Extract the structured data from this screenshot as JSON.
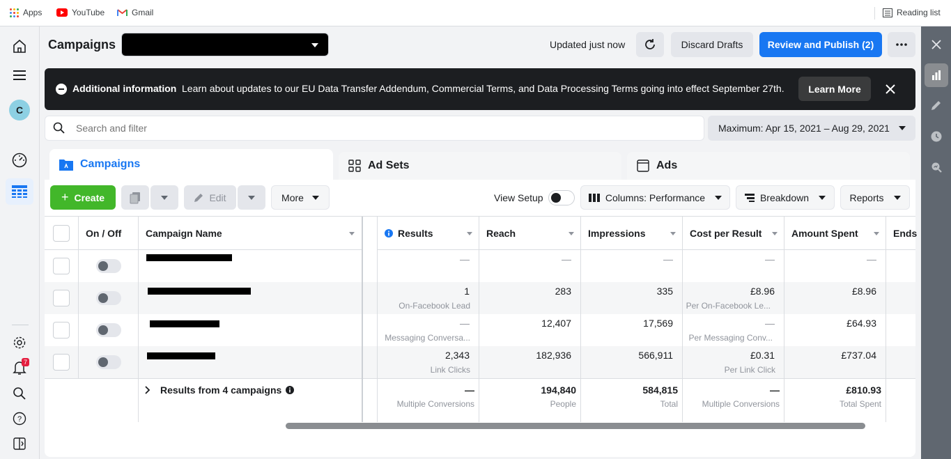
{
  "bookmarks": {
    "apps": "Apps",
    "youtube": "YouTube",
    "gmail": "Gmail",
    "reading_list": "Reading list"
  },
  "header": {
    "title": "Campaigns",
    "updated": "Updated just now",
    "discard": "Discard Drafts",
    "publish": "Review and Publish (2)"
  },
  "banner": {
    "title": "Additional information",
    "message": "Learn about updates to our EU Data Transfer Addendum, Commercial Terms, and Data Processing Terms going into effect September 27th.",
    "learn_more": "Learn More"
  },
  "search": {
    "placeholder": "Search and filter"
  },
  "date_range": "Maximum: Apr 15, 2021 – Aug 29, 2021",
  "tabs": {
    "campaigns": "Campaigns",
    "adsets": "Ad Sets",
    "ads": "Ads"
  },
  "toolbar": {
    "create": "Create",
    "edit": "Edit",
    "more": "More",
    "view_setup": "View Setup",
    "columns": "Columns: Performance",
    "breakdown": "Breakdown",
    "reports": "Reports"
  },
  "table": {
    "headers": {
      "onoff": "On / Off",
      "name": "Campaign Name",
      "results": "Results",
      "reach": "Reach",
      "impressions": "Impressions",
      "cpr": "Cost per Result",
      "amount": "Amount Spent",
      "ends": "Ends"
    },
    "rows": [
      {
        "results": "—",
        "results_sub": "",
        "reach": "—",
        "impressions": "—",
        "cpr": "—",
        "cpr_sub": "",
        "amount": "—"
      },
      {
        "results": "1",
        "results_sub": "On-Facebook Lead",
        "reach": "283",
        "impressions": "335",
        "cpr": "£8.96",
        "cpr_sub": "Per On-Facebook Le...",
        "amount": "£8.96"
      },
      {
        "results": "—",
        "results_sub": "Messaging Conversa...",
        "reach": "12,407",
        "impressions": "17,569",
        "cpr": "—",
        "cpr_sub": "Per Messaging Conv...",
        "amount": "£64.93"
      },
      {
        "results": "2,343",
        "results_sub": "Link Clicks",
        "reach": "182,936",
        "impressions": "566,911",
        "cpr": "£0.31",
        "cpr_sub": "Per Link Click",
        "amount": "£737.04"
      }
    ],
    "summary": {
      "label": "Results from 4 campaigns",
      "results": "—",
      "results_sub": "Multiple Conversions",
      "reach": "194,840",
      "reach_sub": "People",
      "impressions": "584,815",
      "impressions_sub": "Total",
      "cpr": "—",
      "cpr_sub": "Multiple Conversions",
      "amount": "£810.93",
      "amount_sub": "Total Spent"
    }
  },
  "notification_count": "7",
  "avatar_letter": "C",
  "colors": {
    "publish": "#1877f2",
    "create": "#42b72a",
    "banner": "#1c1e21",
    "rightbar": "#606770"
  }
}
